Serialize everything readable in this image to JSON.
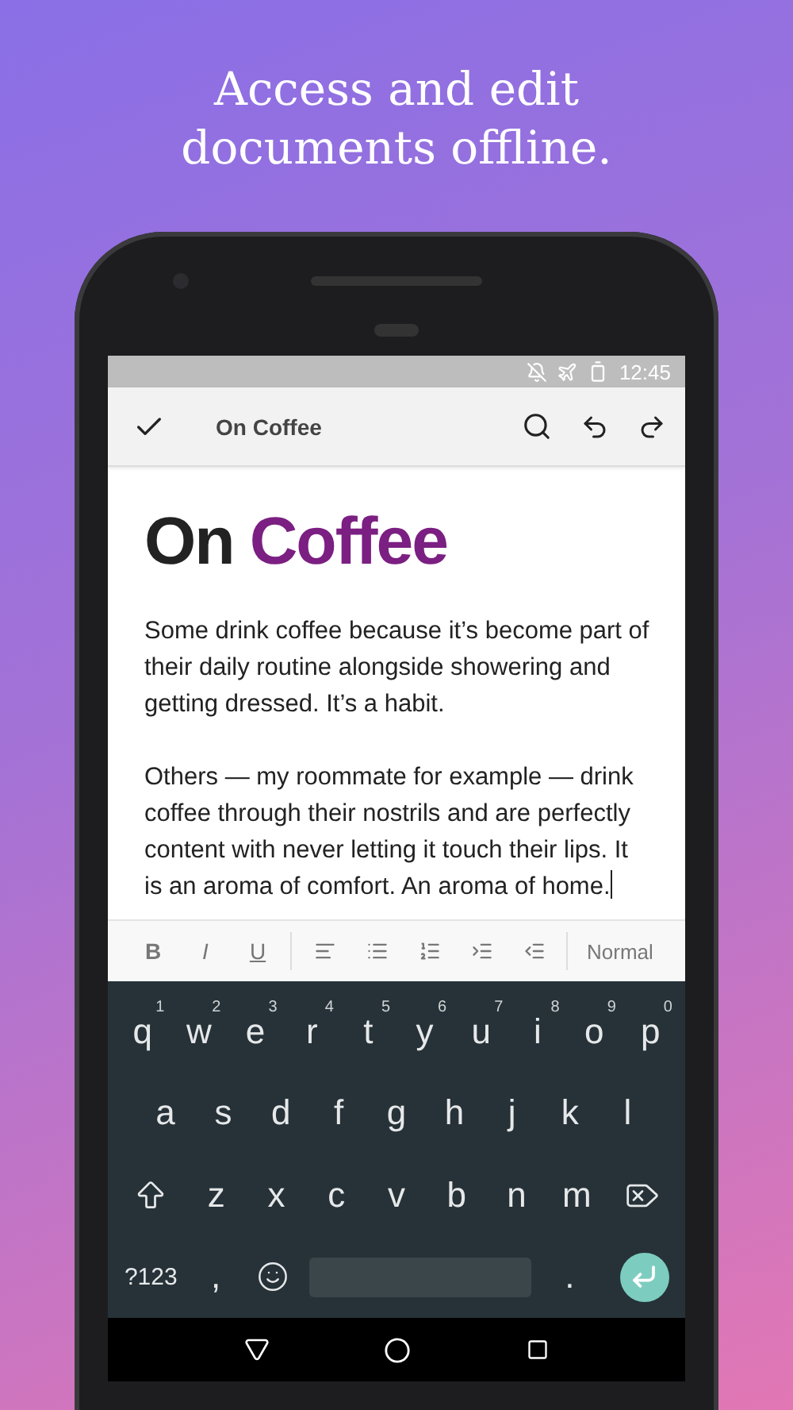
{
  "headline": "Access and edit documents offline.",
  "status_bar": {
    "time": "12:45"
  },
  "app_bar": {
    "title": "On Coffee"
  },
  "document": {
    "title_parts": [
      {
        "text": "On",
        "accent": false
      },
      {
        "text": "Coffee",
        "accent": true
      }
    ],
    "paragraphs": [
      "Some drink coffee because it’s become part of their daily routine alongside showering and getting dressed. It’s a habit.",
      "Others — my roommate for example — drink coffee through their nostrils and are perfectly content with never letting it touch their lips. It is an aroma of comfort. An aroma of home."
    ]
  },
  "format_toolbar": {
    "buttons": [
      {
        "kind": "bold",
        "label": "B"
      },
      {
        "kind": "italic",
        "label": "I"
      },
      {
        "kind": "underline",
        "label": "U"
      },
      {
        "kind": "divider"
      },
      {
        "kind": "align-left"
      },
      {
        "kind": "list-bullet"
      },
      {
        "kind": "list-number"
      },
      {
        "kind": "indent"
      },
      {
        "kind": "outdent"
      },
      {
        "kind": "divider"
      },
      {
        "kind": "style",
        "label": "Normal"
      }
    ]
  },
  "keyboard": {
    "rows": [
      {
        "keys": [
          {
            "kind": "letter",
            "label": "q",
            "hint": "1"
          },
          {
            "kind": "letter",
            "label": "w",
            "hint": "2"
          },
          {
            "kind": "letter",
            "label": "e",
            "hint": "3"
          },
          {
            "kind": "letter",
            "label": "r",
            "hint": "4"
          },
          {
            "kind": "letter",
            "label": "t",
            "hint": "5"
          },
          {
            "kind": "letter",
            "label": "y",
            "hint": "6"
          },
          {
            "kind": "letter",
            "label": "u",
            "hint": "7"
          },
          {
            "kind": "letter",
            "label": "i",
            "hint": "8"
          },
          {
            "kind": "letter",
            "label": "o",
            "hint": "9"
          },
          {
            "kind": "letter",
            "label": "p",
            "hint": "0"
          }
        ]
      },
      {
        "keys": [
          {
            "kind": "letter",
            "label": "a"
          },
          {
            "kind": "letter",
            "label": "s"
          },
          {
            "kind": "letter",
            "label": "d"
          },
          {
            "kind": "letter",
            "label": "f"
          },
          {
            "kind": "letter",
            "label": "g"
          },
          {
            "kind": "letter",
            "label": "h"
          },
          {
            "kind": "letter",
            "label": "j"
          },
          {
            "kind": "letter",
            "label": "k"
          },
          {
            "kind": "letter",
            "label": "l"
          }
        ]
      },
      {
        "keys": [
          {
            "kind": "shift"
          },
          {
            "kind": "letter",
            "label": "z"
          },
          {
            "kind": "letter",
            "label": "x"
          },
          {
            "kind": "letter",
            "label": "c"
          },
          {
            "kind": "letter",
            "label": "v"
          },
          {
            "kind": "letter",
            "label": "b"
          },
          {
            "kind": "letter",
            "label": "n"
          },
          {
            "kind": "letter",
            "label": "m"
          },
          {
            "kind": "backspace"
          }
        ]
      },
      {
        "keys": [
          {
            "kind": "symbols",
            "label": "?123"
          },
          {
            "kind": "letter",
            "label": ","
          },
          {
            "kind": "emoji"
          },
          {
            "kind": "space"
          },
          {
            "kind": "letter",
            "label": "."
          },
          {
            "kind": "enter"
          }
        ]
      }
    ]
  }
}
